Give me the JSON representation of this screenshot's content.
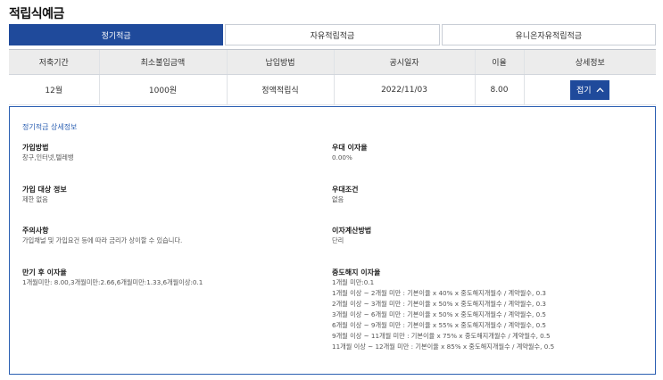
{
  "page_title": "적립식예금",
  "tabs": [
    {
      "label": "정기적금",
      "active": true
    },
    {
      "label": "자유적립적금",
      "active": false
    },
    {
      "label": "유니온자유적립적금",
      "active": false
    }
  ],
  "table": {
    "headers": [
      "저축기간",
      "최소불입금액",
      "납입방법",
      "공시일자",
      "이율",
      "상세정보"
    ],
    "row": {
      "period": "12월",
      "min_amount": "1000원",
      "payment_method": "정액적립식",
      "notice_date": "2022/11/03",
      "rate": "8.00",
      "button_label": "접기"
    }
  },
  "detail": {
    "title": "정기적금 상세정보",
    "join_method": {
      "label": "가입방법",
      "value": "창구,인터넷,텔레뱅"
    },
    "preferential_rate": {
      "label": "우대 이자율",
      "value": "0.00%"
    },
    "eligibility": {
      "label": "가입 대상 정보",
      "value": "제한 없음"
    },
    "preferential_condition": {
      "label": "우대조건",
      "value": "없음"
    },
    "caution": {
      "label": "주의사항",
      "value": "가입채널 및 가입요건 등에 따라 금리가 상이할 수 있습니다."
    },
    "interest_method": {
      "label": "이자계산방법",
      "value": "단리"
    },
    "maturity_rate": {
      "label": "만기 후 이자율",
      "value": "1개월미만: 8.00,3개월미만:2.66,6개월미만:1.33,6개월이상:0.1"
    },
    "early_termination": {
      "label": "중도해지 이자율",
      "lines": [
        "1개월 미만:0.1",
        "1개월 이상 ~ 2개월 미만 : 기본이율 x 40% x 중도해지개월수 / 계약월수, 0.3",
        "2개월 이상 ~ 3개월 미만 : 기본이율 x 50% x 중도해지개월수 / 계약월수, 0.3",
        "3개월 이상 ~ 6개월 미만 : 기본이율 x 50% x 중도해지개월수 / 계약월수, 0.5",
        "6개월 이상 ~ 9개월 미만 : 기본이율 x 55% x 중도해지개월수 / 계약월수, 0.5",
        "9개월 이상 ~ 11개월 미만 : 기본이율 x 75% x 중도해지개월수 / 계약월수, 0.5",
        "11개월 이상 ~ 12개월 미만 : 기본이율 x 85% x 중도해지개월수 / 계약월수, 0.5"
      ]
    }
  },
  "colors": {
    "accent": "#1f4a9b",
    "detail_border": "#2b5fb2",
    "header_bg": "#ececec"
  },
  "icons": {
    "fold_button": "chevron-up-icon"
  }
}
